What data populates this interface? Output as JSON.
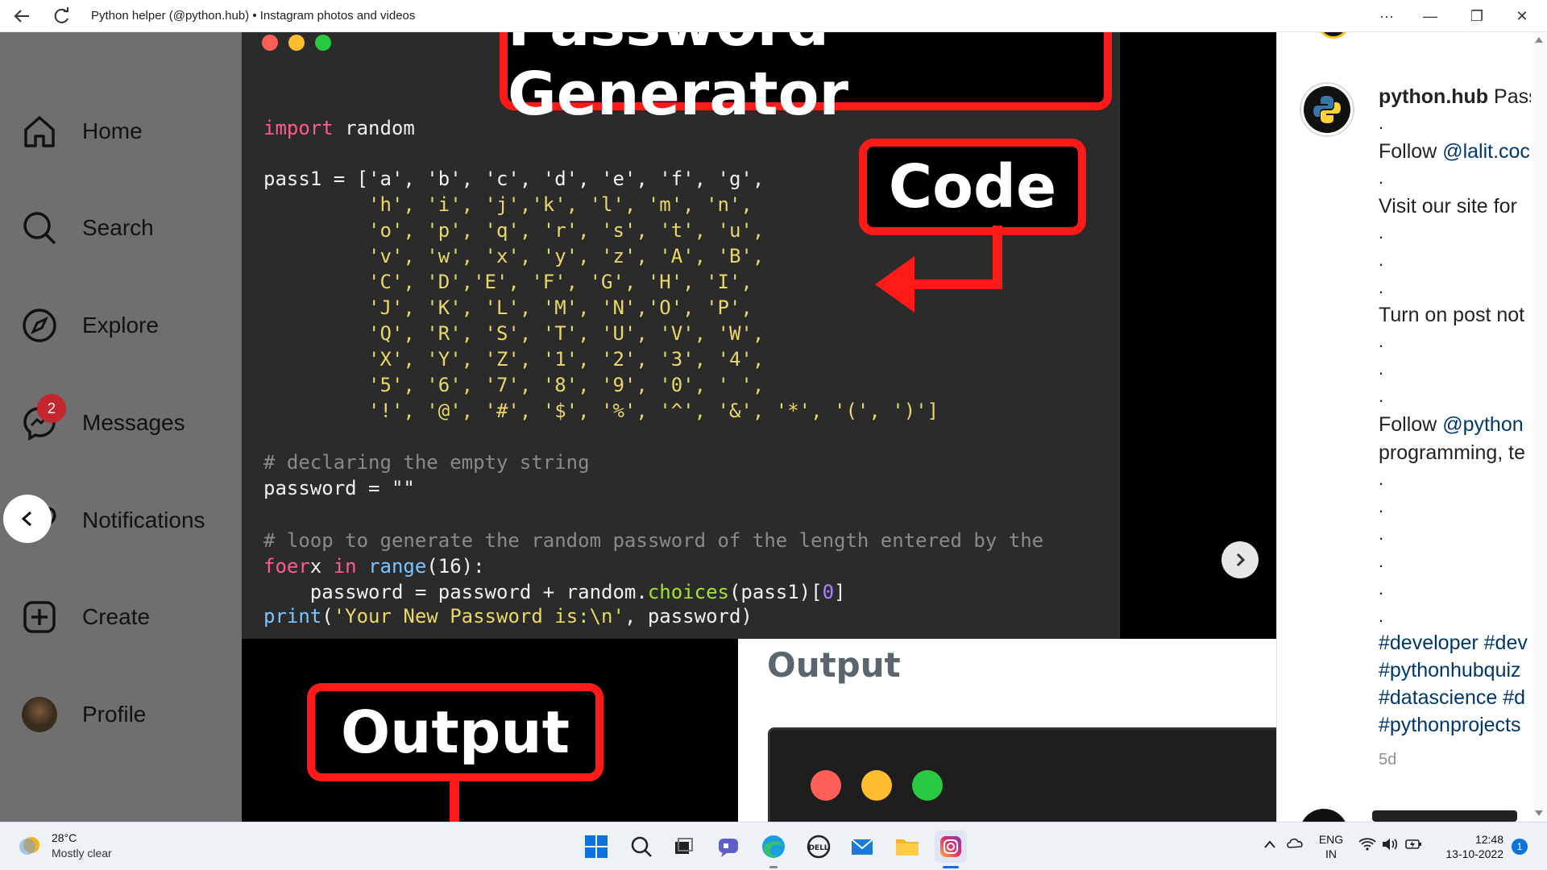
{
  "window": {
    "title": "Python helper (@python.hub) • Instagram photos and videos",
    "minimize_glyph": "—",
    "restore_glyph": "❐",
    "close_glyph": "✕",
    "more_glyph": "···"
  },
  "nav": {
    "items": [
      {
        "label": "Home",
        "icon": "home-icon"
      },
      {
        "label": "Search",
        "icon": "search-icon"
      },
      {
        "label": "Explore",
        "icon": "compass-icon"
      },
      {
        "label": "Messages",
        "icon": "messenger-icon",
        "badge": "2"
      },
      {
        "label": "Notifications",
        "icon": "heart-icon"
      },
      {
        "label": "Create",
        "icon": "plus-square-icon"
      },
      {
        "label": "Profile",
        "icon": "avatar"
      }
    ]
  },
  "post": {
    "title_banner": "Password Generator",
    "code_banner": "Code",
    "output_banner": "Output",
    "output_heading": "Output",
    "code_lines": {
      "l1_kw": "import",
      "l1_rest": " random",
      "l2": "pass1 = ['a', 'b', 'c', 'd', 'e', 'f', 'g',",
      "l3": "         'h', 'i', 'j','k', 'l', 'm', 'n',",
      "l4": "         'o', 'p', 'q', 'r', 's', 't', 'u',",
      "l5": "         'v', 'w', 'x', 'y', 'z', 'A', 'B',",
      "l6": "         'C', 'D','E', 'F', 'G', 'H', 'I',",
      "l7": "         'J', 'K', 'L', 'M', 'N','O', 'P',",
      "l8": "         'Q', 'R', 'S', 'T', 'U', 'V', 'W',",
      "l9": "         'X', 'Y', 'Z', '1', '2', '3', '4',",
      "l10": "         '5', '6', '7', '8', '9', '0', ' ',",
      "l11": "         '!', '@', '#', '$', '%', '^', '&', '*', '(', ')']",
      "c1": "# declaring the empty string",
      "l12": "password = \"\"",
      "c2": "# loop to generate the random password of the length entered by the",
      "l13_kw": "foer",
      "l13_a": "x ",
      "l13_in": "in",
      "l13_sp": " ",
      "l13_fn": "range",
      "l13_b": "(16):",
      "l14_a": "    password = password + random.",
      "l14_fn": "choices",
      "l14_b": "(pass1)[",
      "l14_num": "0",
      "l14_c": "]",
      "l15_fn": "print",
      "l15_b": "(",
      "l15_str": "'Your New Password is:\\n'",
      "l15_c": ", password)"
    }
  },
  "caption": {
    "username": "python.hub",
    "first_word": "Pass",
    "follow1_prefix": "Follow ",
    "follow1_link": "@lalit.coc",
    "visit": "Visit our site for",
    "turn_on": "Turn on post not",
    "follow2_prefix": "Follow ",
    "follow2_link": "@python",
    "programming": "programming, te",
    "tags1": "#developer #dev",
    "tags2": "#pythonhubquiz",
    "tags3": "#datascience #d",
    "tags4": "#pythonprojects",
    "time": "5d",
    "dot": "."
  },
  "taskbar": {
    "temp": "28°C",
    "weather": "Mostly clear",
    "lang1": "ENG",
    "lang2": "IN",
    "time": "12:48",
    "date": "13-10-2022",
    "notif_count": "1"
  },
  "colors": {
    "accent_red": "#ff1a1a",
    "badge_red": "#c5252d",
    "link": "#00376b"
  }
}
